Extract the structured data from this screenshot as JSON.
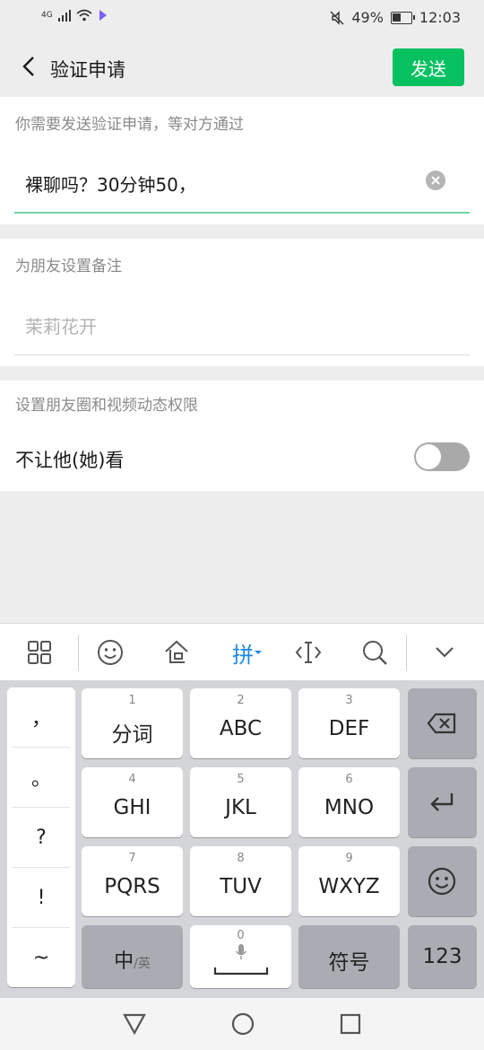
{
  "status_bar": {
    "network": "4G",
    "mute_icon": "mute-icon",
    "battery": "49%",
    "battery_level": 0.49,
    "time": "12:03"
  },
  "header": {
    "back_icon": "back-arrow-icon",
    "title": "验证申请",
    "send_label": "发送",
    "accent_color": "#07c160"
  },
  "verification": {
    "label": "你需要发送验证申请，等对方通过",
    "value": "裸聊吗？30分钟50，",
    "clear_icon": "clear-icon"
  },
  "remark": {
    "label": "为朋友设置备注",
    "placeholder": "茉莉花开"
  },
  "moments": {
    "label": "设置朋友圈和视频动态权限",
    "option_label": "不让他(她)看",
    "toggle_on": false
  },
  "keyboard": {
    "toolbar": {
      "grid_icon": "grid-icon",
      "emoji_icon": "emoji-icon",
      "clipboard_icon": "clipboard-icon",
      "mode_label": "拼",
      "cursor_icon": "cursor-icon",
      "search_icon": "search-icon",
      "collapse_icon": "chevron-down-icon"
    },
    "punctuation": [
      "，",
      "。",
      "?",
      "!",
      "~"
    ],
    "keys": [
      {
        "num": "1",
        "label": "分词"
      },
      {
        "num": "2",
        "label": "ABC"
      },
      {
        "num": "3",
        "label": "DEF"
      },
      {
        "num": "4",
        "label": "GHI"
      },
      {
        "num": "5",
        "label": "JKL"
      },
      {
        "num": "6",
        "label": "MNO"
      },
      {
        "num": "7",
        "label": "PQRS"
      },
      {
        "num": "8",
        "label": "TUV"
      },
      {
        "num": "9",
        "label": "WXYZ"
      }
    ],
    "lang_main": "中",
    "lang_sub": "/英",
    "space_num": "0",
    "symbol_label": "符号",
    "numbers_label": "123",
    "backspace_icon": "backspace-icon",
    "enter_icon": "enter-icon",
    "emoji_key_icon": "emoji-icon",
    "mic_icon": "mic-icon"
  },
  "nav_bar": {
    "back_icon": "triangle-back-icon",
    "home_icon": "circle-home-icon",
    "recents_icon": "square-recents-icon"
  }
}
